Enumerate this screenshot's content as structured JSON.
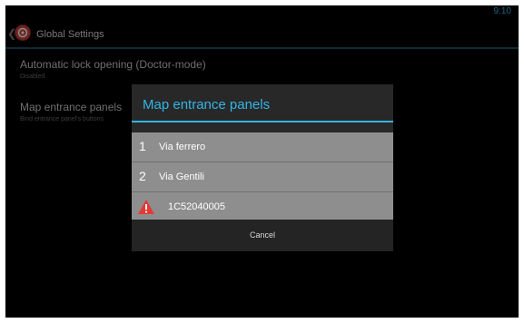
{
  "status_bar": {
    "time": "9:10"
  },
  "action_bar": {
    "title": "Global Settings",
    "icon": "app-logo-icon",
    "up_icon": "up-caret-icon"
  },
  "preferences": [
    {
      "title": "Automatic lock opening (Doctor-mode)",
      "summary": "Disabled"
    },
    {
      "title": "Map entrance panels",
      "summary": "Bind entrance panel's buttons"
    }
  ],
  "dialog": {
    "title": "Map entrance panels",
    "items": [
      {
        "index": "1",
        "label": "Via ferrero"
      },
      {
        "index": "2",
        "label": "Via Gentili"
      },
      {
        "icon": "warning-icon",
        "label": "1C52040005"
      }
    ],
    "cancel_label": "Cancel"
  },
  "colors": {
    "accent": "#33b5e5",
    "background": "#000000",
    "dialog_bg": "#282828",
    "item_bg": "#8e8e8e",
    "warning": "#e53935"
  }
}
